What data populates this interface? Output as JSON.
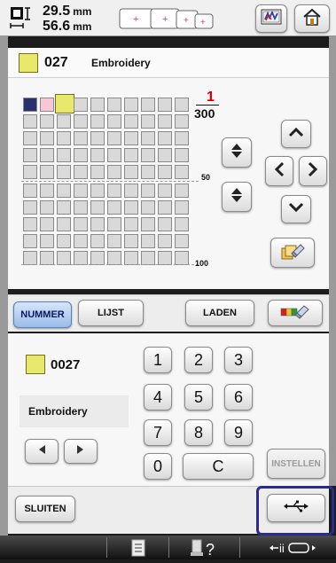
{
  "size": {
    "width_value": "29.5",
    "width_unit": "mm",
    "height_value": "56.6",
    "height_unit": "mm"
  },
  "selected": {
    "number": "027",
    "name": "Embroidery",
    "swatch_color": "#e8e86a"
  },
  "grid": {
    "page_current": "1",
    "page_total": "300",
    "mark_50": "50",
    "mark_100": "100",
    "cells_first_row_colors": [
      "#2a2f6e",
      "#f6c8d6",
      "#e8e86a"
    ]
  },
  "tabs": {
    "number": "NUMMER",
    "list": "LIJST",
    "load": "LADEN"
  },
  "entry": {
    "number": "0027",
    "name": "Embroidery",
    "swatch_color": "#e8e86a"
  },
  "keypad": {
    "keys": [
      "1",
      "2",
      "3",
      "4",
      "5",
      "6",
      "7",
      "8",
      "9",
      "0"
    ],
    "clear": "C",
    "set": "INSTELLEN"
  },
  "footer": {
    "close": "SLUITEN"
  },
  "colors": {
    "highlight_border": "#2b2b8f",
    "accent_red": "#cc0000"
  },
  "icons": [
    "thread-color-icon",
    "home-icon",
    "eraser-icon",
    "palette-eraser-icon",
    "usb-icon",
    "checklist-icon",
    "presser-foot-help-icon",
    "usb-connect-icon",
    "arrow-up-icon",
    "arrow-down-icon",
    "arrow-left-icon",
    "arrow-right-icon",
    "page-up-icon",
    "page-down-icon"
  ]
}
